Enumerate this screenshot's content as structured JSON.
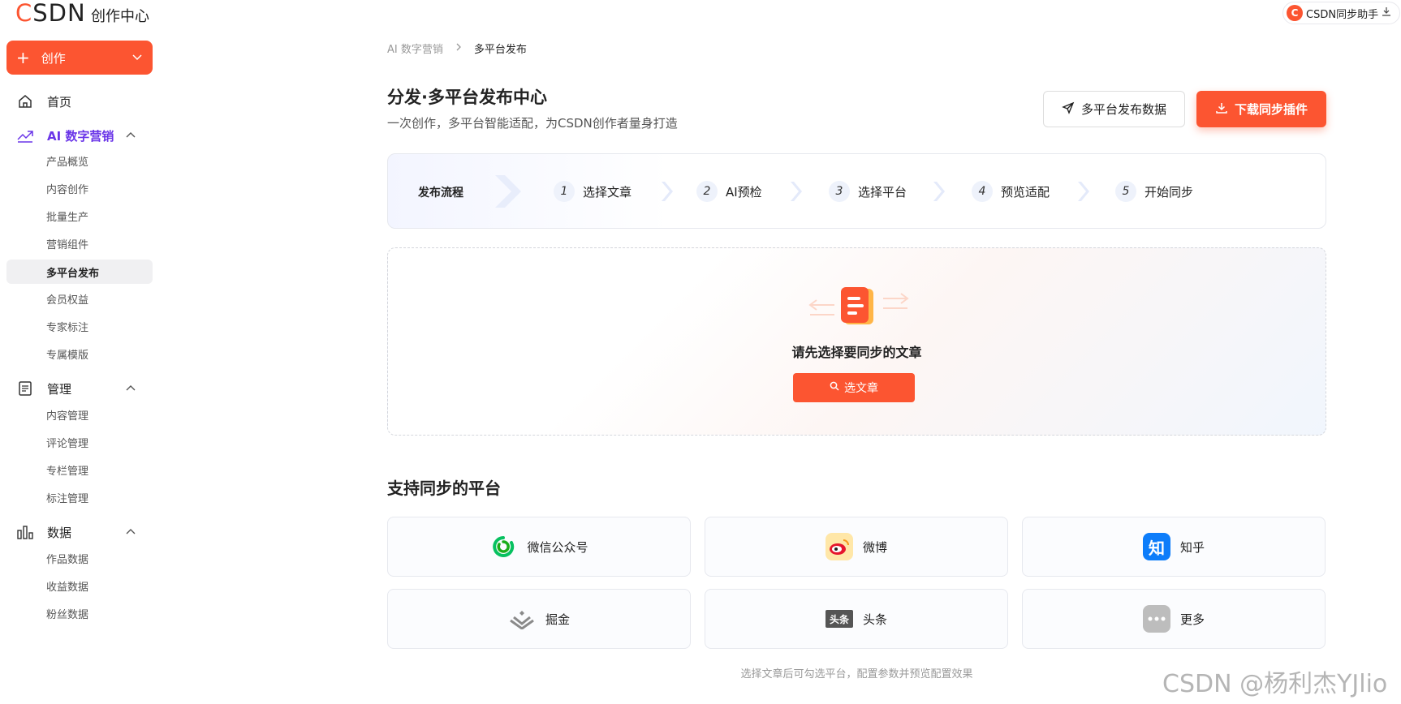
{
  "header": {
    "logo": "CSDN",
    "app_title": "创作中心",
    "sync_helper_label": "CSDN同步助手"
  },
  "sidebar": {
    "create_label": "创作",
    "home_label": "首页",
    "groups": [
      {
        "label": "AI 数字营销",
        "items": [
          "产品概览",
          "内容创作",
          "批量生产",
          "营销组件",
          "多平台发布",
          "会员权益",
          "专家标注",
          "专属模版"
        ]
      },
      {
        "label": "管理",
        "items": [
          "内容管理",
          "评论管理",
          "专栏管理",
          "标注管理"
        ]
      },
      {
        "label": "数据",
        "items": [
          "作品数据",
          "收益数据",
          "粉丝数据"
        ]
      }
    ],
    "active_item": "多平台发布"
  },
  "breadcrumb": {
    "parent": "AI 数字营销",
    "current": "多平台发布"
  },
  "page": {
    "title": "分发·多平台发布中心",
    "subtitle": "一次创作，多平台智能适配，为CSDN创作者量身打造",
    "data_button": "多平台发布数据",
    "plugin_button": "下载同步插件"
  },
  "flow": {
    "title": "发布流程",
    "steps": [
      {
        "num": "1",
        "label": "选择文章"
      },
      {
        "num": "2",
        "label": "AI预检"
      },
      {
        "num": "3",
        "label": "选择平台"
      },
      {
        "num": "4",
        "label": "预览适配"
      },
      {
        "num": "5",
        "label": "开始同步"
      }
    ]
  },
  "empty_state": {
    "message": "请先选择要同步的文章",
    "button": "选文章"
  },
  "platforms": {
    "title": "支持同步的平台",
    "items": [
      "微信公众号",
      "微博",
      "知乎",
      "掘金",
      "头条",
      "更多"
    ],
    "zhihu_icon_text": "知",
    "toutiao_icon_text": "头条",
    "footnote": "选择文章后可勾选平台，配置参数并预览配置效果"
  },
  "watermark": "CSDN @杨利杰YJlio",
  "colors": {
    "accent": "#fc5531",
    "ai_purple": "#6a35e8",
    "wechat": "#07c160",
    "zhihu": "#0d7dfa"
  }
}
